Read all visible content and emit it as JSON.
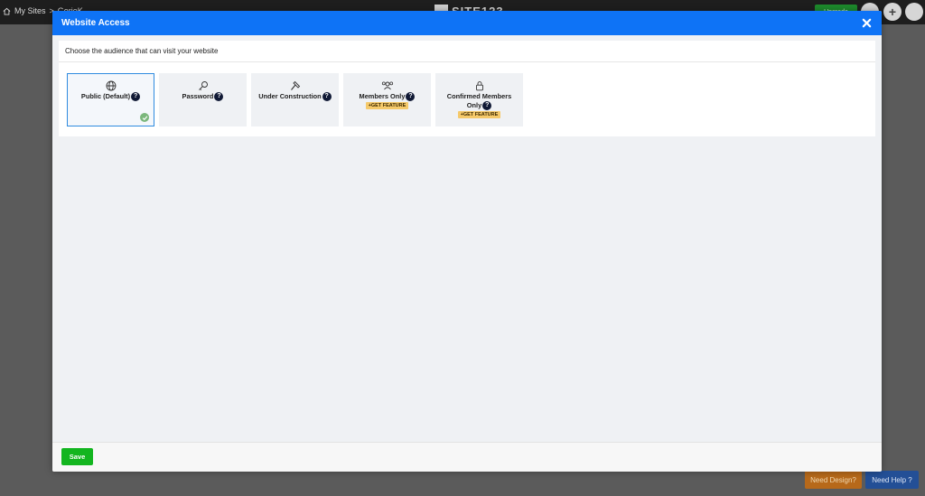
{
  "background": {
    "breadcrumb": {
      "home": "My Sites",
      "separator": ">",
      "site": "GorieK"
    },
    "logo": "SITE123",
    "upgrade_label": "Upgrade",
    "need_design_label": "Need Design?",
    "need_help_label": "Need Help ?"
  },
  "modal": {
    "title": "Website Access",
    "prompt": "Choose the audience that can visit your website",
    "options": [
      {
        "label": "Public (Default)",
        "icon": "globe-icon",
        "selected": true,
        "badge": ""
      },
      {
        "label": "Password",
        "icon": "key-icon",
        "selected": false,
        "badge": ""
      },
      {
        "label": "Under Construction",
        "icon": "hammer-icon",
        "selected": false,
        "badge": ""
      },
      {
        "label": "Members Only",
        "icon": "users-icon",
        "selected": false,
        "badge": "+GET FEATURE"
      },
      {
        "label": "Confirmed Members Only",
        "icon": "lock-icon",
        "selected": false,
        "badge": "+GET FEATURE"
      }
    ],
    "help_glyph": "?",
    "save_label": "Save"
  },
  "colors": {
    "header": "#0e73f6",
    "save": "#13b51f",
    "selected_border": "#2f8be0",
    "badge": "#f5c96a"
  }
}
